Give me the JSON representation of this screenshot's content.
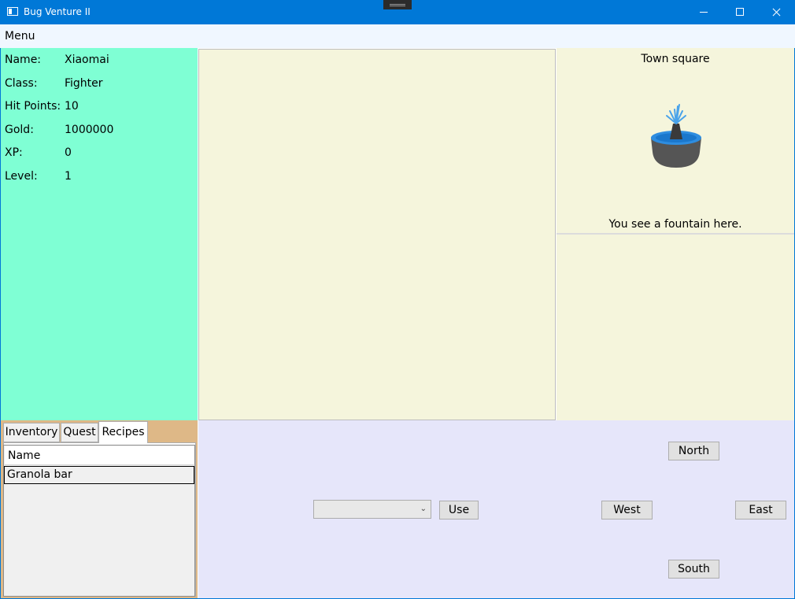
{
  "window": {
    "title": "Bug Venture II"
  },
  "menubar": {
    "menu_label": "Menu"
  },
  "player": {
    "stats": [
      {
        "label": "Name:",
        "value": "Xiaomai"
      },
      {
        "label": "Class:",
        "value": "Fighter"
      },
      {
        "label": "Hit Points:",
        "value": "10"
      },
      {
        "label": "Gold:",
        "value": "1000000"
      },
      {
        "label": "XP:",
        "value": "0"
      },
      {
        "label": "Level:",
        "value": "1"
      }
    ]
  },
  "location": {
    "name": "Town square",
    "description": "You see a fountain here.",
    "image_icon": "fountain-icon"
  },
  "tabs": {
    "items": [
      "Inventory",
      "Quest",
      "Recipes"
    ],
    "selected": "Recipes"
  },
  "recipes": {
    "columns": [
      "Name"
    ],
    "rows": [
      {
        "name": "Granola bar"
      }
    ]
  },
  "actions": {
    "consumable_selected": "",
    "use_label": "Use",
    "north_label": "North",
    "west_label": "West",
    "east_label": "East",
    "south_label": "South"
  },
  "colors": {
    "titlebar": "#0078d7",
    "player_panel": "#7fffd4",
    "game_panel": "#f5f5dc",
    "tab_panel": "#deb887",
    "action_panel": "#e6e6fa"
  }
}
